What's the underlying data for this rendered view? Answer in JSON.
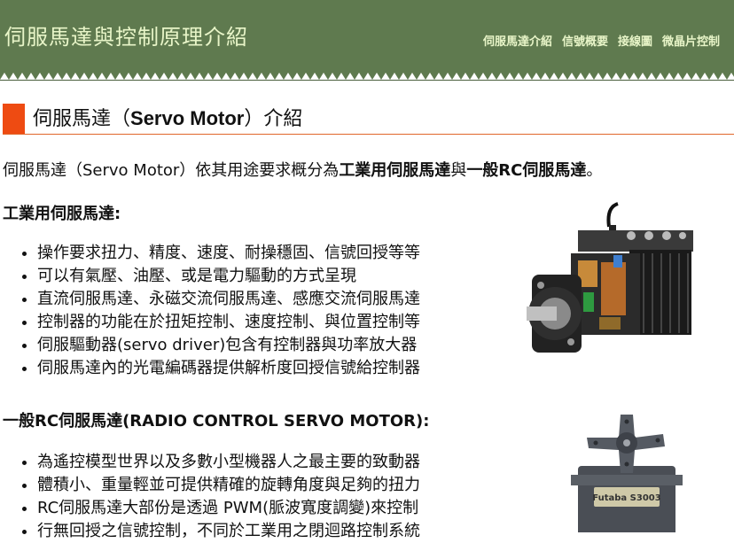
{
  "site": {
    "title": "伺服馬達與控制原理介紹"
  },
  "nav": [
    "伺服馬達介紹",
    "信號概要",
    "接線圖",
    "微晶片控制"
  ],
  "heading": {
    "pre": "伺服馬達（",
    "bold": "Servo Motor",
    "post": "）介紹"
  },
  "intro": {
    "p1": "伺服馬達（Servo Motor）依其用途要求概分為",
    "b1": "工業用伺服馬達",
    "p2": "與",
    "b2": "一般RC伺服馬達",
    "p3": "。"
  },
  "industrial": {
    "title": "工業用伺服馬達:",
    "items": [
      "操作要求扭力、精度、速度、耐操穩固、信號回授等等",
      "可以有氣壓、油壓、或是電力驅動的方式呈現",
      "直流伺服馬達、永磁交流伺服馬達、感應交流伺服馬達",
      "控制器的功能在於扭矩控制、速度控制、與位置控制等",
      "伺服驅動器(servo driver)包含有控制器與功率放大器",
      "伺服馬達內的光電編碼器提供解析度回授信號給控制器"
    ]
  },
  "rc": {
    "title": "一般RC伺服馬達(RADIO CONTROL SERVO MOTOR):",
    "items": [
      "為遙控模型世界以及多數小型機器人之最主要的致動器",
      "體積小、重量輕並可提供精確的旋轉角度與足夠的扭力",
      "RC伺服馬達大部份是透過 PWM(脈波寬度調變)來控制",
      "行無回授之信號控制，不同於工業用之閉迴路控制系統"
    ],
    "label_text": "Futaba S3003"
  },
  "colors": {
    "header": "#5f7a4f",
    "accent": "#ee4b12",
    "title_text": "#e8f5c8"
  }
}
